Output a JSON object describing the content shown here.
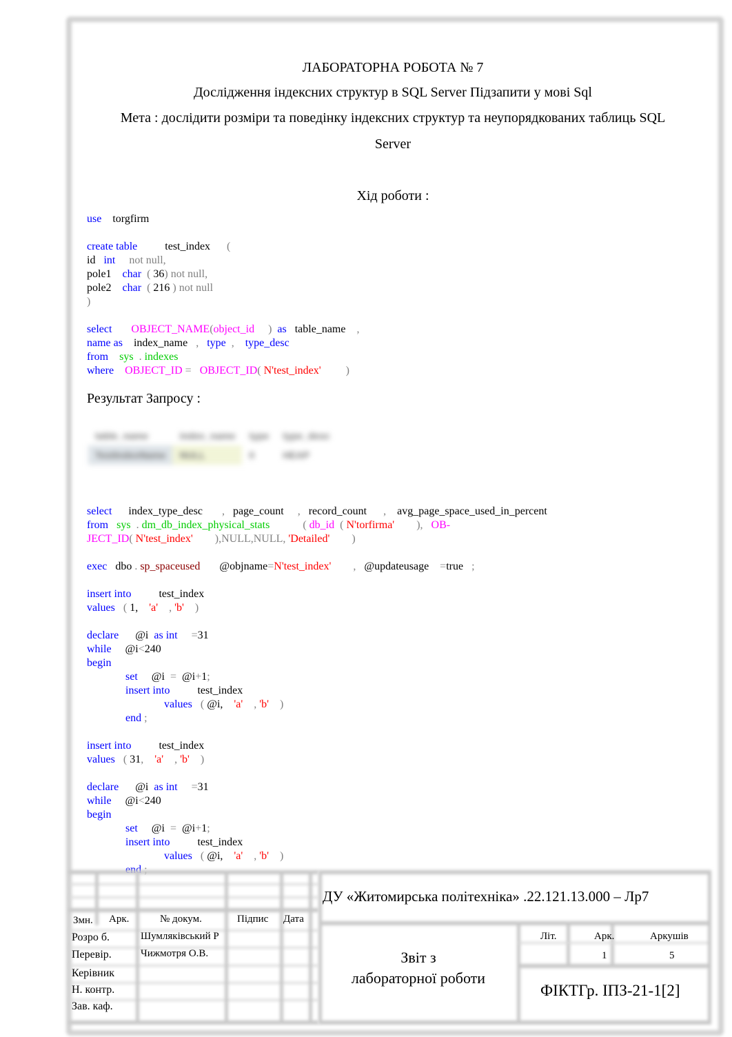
{
  "document": {
    "title": "ЛАБОРАТОРНА    РОБОТА   № 7",
    "subtitle": "Дослідження індексних структур в SQL Server Підзапити у мові Sql",
    "goal_line1": "Мета :  дослідити розміри та поведінку індексних структур та неупорядкованих  таблиць SQL",
    "goal_line2": "Server",
    "progress_heading": "Хід роботи :",
    "result_label": "Результат Запросу :"
  },
  "code_block_1": [
    [
      {
        "t": "use",
        "c": "kw"
      },
      {
        "t": "    torgfirm",
        "c": ""
      }
    ],
    [],
    [
      {
        "t": "create table",
        "c": "kw"
      },
      {
        "t": "          test_index      ",
        "c": ""
      },
      {
        "t": "(",
        "c": "gr"
      }
    ],
    [
      {
        "t": "id   ",
        "c": ""
      },
      {
        "t": "int",
        "c": "kw"
      },
      {
        "t": "     not null,",
        "c": "gr"
      }
    ],
    [
      {
        "t": "pole1    ",
        "c": ""
      },
      {
        "t": "char",
        "c": "kw"
      },
      {
        "t": "  ( ",
        "c": "gr"
      },
      {
        "t": "36",
        "c": ""
      },
      {
        "t": ") not null,",
        "c": "gr"
      }
    ],
    [
      {
        "t": "pole2    ",
        "c": ""
      },
      {
        "t": "char",
        "c": "kw"
      },
      {
        "t": "  ( ",
        "c": "gr"
      },
      {
        "t": "216",
        "c": ""
      },
      {
        "t": " ) not null",
        "c": "gr"
      }
    ],
    [
      {
        "t": ")",
        "c": "gr"
      }
    ],
    [],
    [
      {
        "t": "select",
        "c": "kw"
      },
      {
        "t": "       ",
        "c": ""
      },
      {
        "t": "OBJECT_NAME",
        "c": "fn"
      },
      {
        "t": "(",
        "c": "gr"
      },
      {
        "t": "object_id",
        "c": "fn"
      },
      {
        "t": "     ) ",
        "c": "gr"
      },
      {
        "t": " as",
        "c": "kw"
      },
      {
        "t": "   table_name    ",
        "c": ""
      },
      {
        "t": ",",
        "c": "gr"
      }
    ],
    [
      {
        "t": "name as",
        "c": "kw"
      },
      {
        "t": "    index_name   ",
        "c": ""
      },
      {
        "t": ",",
        "c": "gr"
      },
      {
        "t": "   type",
        "c": "kw"
      },
      {
        "t": "  ,",
        "c": "gr"
      },
      {
        "t": "    type_desc",
        "c": "kw"
      }
    ],
    [
      {
        "t": "from",
        "c": "kw"
      },
      {
        "t": "    ",
        "c": ""
      },
      {
        "t": "sys",
        "c": "sys"
      },
      {
        "t": "  . ",
        "c": "gr"
      },
      {
        "t": "indexes",
        "c": "sys"
      }
    ],
    [
      {
        "t": "where",
        "c": "kw"
      },
      {
        "t": "    ",
        "c": ""
      },
      {
        "t": "OBJECT_ID",
        "c": "fn"
      },
      {
        "t": " =   ",
        "c": "gr"
      },
      {
        "t": "OBJECT_ID",
        "c": "fn"
      },
      {
        "t": "( ",
        "c": "gr"
      },
      {
        "t": "N'test_index'",
        "c": "str"
      },
      {
        "t": "         )",
        "c": "gr"
      }
    ]
  ],
  "result_table": {
    "headers": [
      "table_name",
      "index_name",
      "type",
      "type_desc"
    ],
    "rows": [
      [
        "TestIndexName",
        "NULL",
        "0",
        "HEAP"
      ]
    ]
  },
  "code_block_2": [
    [
      {
        "t": "select",
        "c": "kw"
      },
      {
        "t": "      index_type_desc       ",
        "c": ""
      },
      {
        "t": ",",
        "c": "gr"
      },
      {
        "t": "   page_count     ",
        "c": ""
      },
      {
        "t": ",",
        "c": "gr"
      },
      {
        "t": "   record_count      ",
        "c": ""
      },
      {
        "t": ",",
        "c": "gr"
      },
      {
        "t": "    avg_page_space_used_in_percent",
        "c": ""
      }
    ],
    [
      {
        "t": "from",
        "c": "kw"
      },
      {
        "t": "   ",
        "c": ""
      },
      {
        "t": "sys",
        "c": "sys"
      },
      {
        "t": "  . ",
        "c": "gr"
      },
      {
        "t": "dm_db_index_physical_stats",
        "c": "sys"
      },
      {
        "t": "            ( ",
        "c": "gr"
      },
      {
        "t": "db_id",
        "c": "fn"
      },
      {
        "t": "  ( ",
        "c": "gr"
      },
      {
        "t": "N'torfirma'",
        "c": "str"
      },
      {
        "t": "        ),   ",
        "c": "gr"
      },
      {
        "t": "OB-",
        "c": "fn"
      }
    ],
    [
      {
        "t": "JECT_ID",
        "c": "fn"
      },
      {
        "t": "( ",
        "c": "gr"
      },
      {
        "t": "N'test_index'",
        "c": "str"
      },
      {
        "t": "        ),NULL,NULL, ",
        "c": "gr"
      },
      {
        "t": "'Detailed'",
        "c": "str"
      },
      {
        "t": "        )",
        "c": "gr"
      }
    ],
    [],
    [
      {
        "t": "exec",
        "c": "kw"
      },
      {
        "t": "   dbo",
        "c": ""
      },
      {
        "t": " . ",
        "c": "gr"
      },
      {
        "t": "sp_spaceused",
        "c": "pr"
      },
      {
        "t": "       @objname",
        "c": ""
      },
      {
        "t": "=",
        "c": "gr"
      },
      {
        "t": "N'test_index'",
        "c": "str"
      },
      {
        "t": "        ,",
        "c": "gr"
      },
      {
        "t": "   @updateusage    ",
        "c": ""
      },
      {
        "t": "=",
        "c": "gr"
      },
      {
        "t": "true",
        "c": ""
      },
      {
        "t": "   ;",
        "c": "gr"
      }
    ],
    [],
    [
      {
        "t": "insert into",
        "c": "kw"
      },
      {
        "t": "          test_index",
        "c": ""
      }
    ],
    [
      {
        "t": "values",
        "c": "kw"
      },
      {
        "t": "   ( ",
        "c": "gr"
      },
      {
        "t": "1,",
        "c": ""
      },
      {
        "t": "    ",
        "c": ""
      },
      {
        "t": "'a'",
        "c": "str"
      },
      {
        "t": "    , ",
        "c": "gr"
      },
      {
        "t": "'b'",
        "c": "str"
      },
      {
        "t": "    )",
        "c": "gr"
      }
    ],
    [],
    [
      {
        "t": "declare",
        "c": "kw"
      },
      {
        "t": "      @i  ",
        "c": ""
      },
      {
        "t": "as int",
        "c": "kw"
      },
      {
        "t": "     ",
        "c": ""
      },
      {
        "t": "=",
        "c": "gr"
      },
      {
        "t": "31",
        "c": ""
      }
    ],
    [
      {
        "t": "while",
        "c": "kw"
      },
      {
        "t": "     @i",
        "c": ""
      },
      {
        "t": "<",
        "c": "gr"
      },
      {
        "t": "240",
        "c": ""
      }
    ],
    [
      {
        "t": "begin",
        "c": "kw"
      }
    ],
    [
      {
        "t": "              ",
        "c": ""
      },
      {
        "t": "set",
        "c": "kw"
      },
      {
        "t": "     @i  ",
        "c": ""
      },
      {
        "t": "=",
        "c": "gr"
      },
      {
        "t": "  @i",
        "c": ""
      },
      {
        "t": "+",
        "c": "gr"
      },
      {
        "t": "1",
        "c": ""
      },
      {
        "t": ";",
        "c": "gr"
      }
    ],
    [
      {
        "t": "              ",
        "c": ""
      },
      {
        "t": "insert into",
        "c": "kw"
      },
      {
        "t": "          test_index",
        "c": ""
      }
    ],
    [
      {
        "t": "                            ",
        "c": ""
      },
      {
        "t": "values",
        "c": "kw"
      },
      {
        "t": "   ( ",
        "c": "gr"
      },
      {
        "t": "@i,",
        "c": ""
      },
      {
        "t": "    ",
        "c": ""
      },
      {
        "t": "'a'",
        "c": "str"
      },
      {
        "t": "    , ",
        "c": "gr"
      },
      {
        "t": "'b'",
        "c": "str"
      },
      {
        "t": "    )",
        "c": "gr"
      }
    ],
    [
      {
        "t": "              ",
        "c": ""
      },
      {
        "t": "end",
        "c": "kw"
      },
      {
        "t": " ;",
        "c": "gr"
      }
    ],
    [],
    [
      {
        "t": "insert into",
        "c": "kw"
      },
      {
        "t": "          test_index",
        "c": ""
      }
    ],
    [
      {
        "t": "values",
        "c": "kw"
      },
      {
        "t": "   ( ",
        "c": "gr"
      },
      {
        "t": "31",
        "c": ""
      },
      {
        "t": ",",
        "c": "gr"
      },
      {
        "t": "    ",
        "c": ""
      },
      {
        "t": "'a'",
        "c": "str"
      },
      {
        "t": "    , ",
        "c": "gr"
      },
      {
        "t": "'b'",
        "c": "str"
      },
      {
        "t": "    )",
        "c": "gr"
      }
    ],
    [],
    [
      {
        "t": "declare",
        "c": "kw"
      },
      {
        "t": "      @i  ",
        "c": ""
      },
      {
        "t": "as int",
        "c": "kw"
      },
      {
        "t": "     ",
        "c": ""
      },
      {
        "t": "=",
        "c": "gr"
      },
      {
        "t": "31",
        "c": ""
      }
    ],
    [
      {
        "t": "while",
        "c": "kw"
      },
      {
        "t": "     @i",
        "c": ""
      },
      {
        "t": "<",
        "c": "gr"
      },
      {
        "t": "240",
        "c": ""
      }
    ],
    [
      {
        "t": "begin",
        "c": "kw"
      }
    ],
    [
      {
        "t": "              ",
        "c": ""
      },
      {
        "t": "set",
        "c": "kw"
      },
      {
        "t": "     @i  ",
        "c": ""
      },
      {
        "t": "=",
        "c": "gr"
      },
      {
        "t": "  @i",
        "c": ""
      },
      {
        "t": "+",
        "c": "gr"
      },
      {
        "t": "1",
        "c": ""
      },
      {
        "t": ";",
        "c": "gr"
      }
    ],
    [
      {
        "t": "              ",
        "c": ""
      },
      {
        "t": "insert into",
        "c": "kw"
      },
      {
        "t": "          test_index",
        "c": ""
      }
    ],
    [
      {
        "t": "                            ",
        "c": ""
      },
      {
        "t": "values",
        "c": "kw"
      },
      {
        "t": "   ( ",
        "c": "gr"
      },
      {
        "t": "@i,",
        "c": ""
      },
      {
        "t": "    ",
        "c": ""
      },
      {
        "t": "'a'",
        "c": "str"
      },
      {
        "t": "    , ",
        "c": "gr"
      },
      {
        "t": "'b'",
        "c": "str"
      },
      {
        "t": "    )",
        "c": "gr"
      }
    ],
    [
      {
        "t": "              ",
        "c": ""
      },
      {
        "t": "end",
        "c": "kw"
      },
      {
        "t": " ;",
        "c": "gr"
      }
    ]
  ],
  "stamp": {
    "col_headers": {
      "change": "Змн.",
      "sheet": "Арк.",
      "doc_no": "№ докум.",
      "signature": "Підпис",
      "date": "Дата"
    },
    "roles": [
      {
        "role": "Розро  б.",
        "name": "Шумляківський Р"
      },
      {
        "role": "Перевір.",
        "name": "Чижмотря О.В."
      },
      {
        "role": "Керівник",
        "name": ""
      },
      {
        "role": "Н. контр.",
        "name": ""
      },
      {
        "role": "Зав. каф.",
        "name": ""
      }
    ],
    "org_code": "ДУ «Житомирська політехніка»        .22.121.13.000    – Лр7",
    "doc_title_line1": "Звіт з",
    "doc_title_line2": "лабораторної роботи",
    "lit_label": "Літ.",
    "sheet_label": "Арк.",
    "sheets_label": "Аркушів",
    "sheet_value": "1",
    "sheets_value": "5",
    "group": "ФІКТГр.  ІПЗ-21-1[2]"
  }
}
